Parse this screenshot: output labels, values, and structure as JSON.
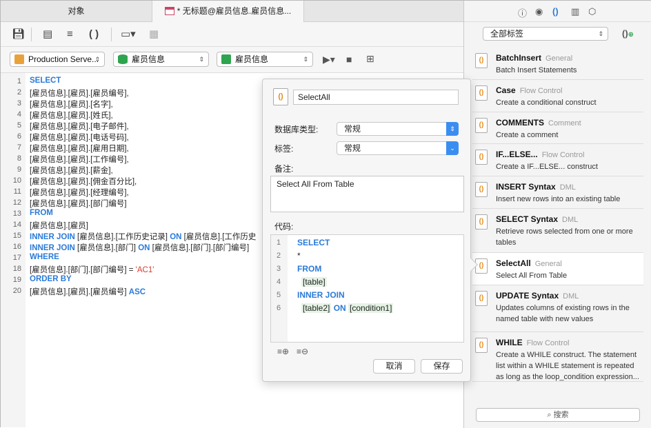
{
  "tabs": [
    {
      "label": "对象"
    },
    {
      "label": "* 无标题@雇员信息.雇员信息..."
    }
  ],
  "selectors": {
    "connection": "Production Serve...",
    "database": "雇员信息",
    "schema": "雇员信息"
  },
  "editor": {
    "line_numbers": [
      "1",
      "2",
      "3",
      "4",
      "5",
      "6",
      "7",
      "8",
      "9",
      "10",
      "11",
      "12",
      "13",
      "14",
      "15",
      "16",
      "17",
      "18",
      "19",
      "20"
    ],
    "lines": [
      [
        {
          "t": "SELECT",
          "k": "kw"
        }
      ],
      [
        {
          "t": "[雇员信息].[雇员].[雇员编号],",
          "k": ""
        }
      ],
      [
        {
          "t": "[雇员信息].[雇员].[名字],",
          "k": ""
        }
      ],
      [
        {
          "t": "[雇员信息].[雇员].[姓氏],",
          "k": ""
        }
      ],
      [
        {
          "t": "[雇员信息].[雇员].[电子邮件],",
          "k": ""
        }
      ],
      [
        {
          "t": "[雇员信息].[雇员].[电话号码],",
          "k": ""
        }
      ],
      [
        {
          "t": "[雇员信息].[雇员].[雇用日期],",
          "k": ""
        }
      ],
      [
        {
          "t": "[雇员信息].[雇员].[工作编号],",
          "k": ""
        }
      ],
      [
        {
          "t": "[雇员信息].[雇员].[薪金],",
          "k": ""
        }
      ],
      [
        {
          "t": "[雇员信息].[雇员].[佣金百分比],",
          "k": ""
        }
      ],
      [
        {
          "t": "[雇员信息].[雇员].[经理编号],",
          "k": ""
        }
      ],
      [
        {
          "t": "[雇员信息].[雇员].[部门编号]",
          "k": ""
        }
      ],
      [
        {
          "t": "FROM",
          "k": "kw"
        }
      ],
      [
        {
          "t": "[雇员信息].[雇员]",
          "k": ""
        }
      ],
      [
        {
          "t": "INNER JOIN",
          "k": "kw"
        },
        {
          "t": " [雇员信息].[工作历史记录] ",
          "k": ""
        },
        {
          "t": "ON",
          "k": "kw"
        },
        {
          "t": " [雇员信息].[工作历史",
          "k": ""
        }
      ],
      [
        {
          "t": "INNER JOIN",
          "k": "kw"
        },
        {
          "t": " [雇员信息].[部门] ",
          "k": ""
        },
        {
          "t": "ON",
          "k": "kw"
        },
        {
          "t": " [雇员信息].[部门].[部门编号]",
          "k": ""
        }
      ],
      [
        {
          "t": "WHERE",
          "k": "kw"
        }
      ],
      [
        {
          "t": "[雇员信息].[部门].[部门编号] = ",
          "k": ""
        },
        {
          "t": "'AC1'",
          "k": "str"
        }
      ],
      [
        {
          "t": "ORDER BY",
          "k": "kw"
        }
      ],
      [
        {
          "t": "[雇员信息].[雇员].[雇员编号] ",
          "k": ""
        },
        {
          "t": "ASC",
          "k": "kw"
        }
      ]
    ]
  },
  "popover": {
    "name_value": "SelectAll",
    "db_type_label": "数据库类型:",
    "db_type_value": "常规",
    "tag_label": "标签:",
    "tag_value": "常规",
    "note_label": "备注:",
    "note_value": "Select All From Table",
    "code_label": "代码:",
    "code_line_numbers": [
      "1",
      "2",
      "3",
      "4",
      "5",
      "6"
    ],
    "code_lines": [
      "SELECT",
      "*",
      "FROM",
      "[table]",
      "INNER JOIN",
      "[table2] ON [condition1]"
    ],
    "cancel_label": "取消",
    "save_label": "保存"
  },
  "right_panel": {
    "filter_label": "全部标签",
    "search_label": "搜索",
    "snippets": [
      {
        "name": "BatchInsert",
        "tag": "General",
        "desc": "Batch Insert Statements"
      },
      {
        "name": "Case",
        "tag": "Flow Control",
        "desc": "Create a conditional construct"
      },
      {
        "name": "COMMENTS",
        "tag": "Comment",
        "desc": "Create a comment"
      },
      {
        "name": "IF...ELSE...",
        "tag": "Flow Control",
        "desc": "Create a IF...ELSE... construct"
      },
      {
        "name": "INSERT Syntax",
        "tag": "DML",
        "desc": "Insert new rows into an existing table"
      },
      {
        "name": "SELECT Syntax",
        "tag": "DML",
        "desc": "Retrieve rows selected from one or more tables"
      },
      {
        "name": "SelectAll",
        "tag": "General",
        "desc": "Select All From Table"
      },
      {
        "name": "UPDATE Syntax",
        "tag": "DML",
        "desc": "Updates columns of existing rows in the named table with new values"
      },
      {
        "name": "WHILE",
        "tag": "Flow Control",
        "desc": "Create a WHILE construct. The statement list within a WHILE statement is repeated as long as the loop_condition expression..."
      }
    ]
  },
  "colors": {
    "keyword": "#2a7ad8",
    "string": "#d93a2b",
    "accent": "#3b8ef0"
  }
}
